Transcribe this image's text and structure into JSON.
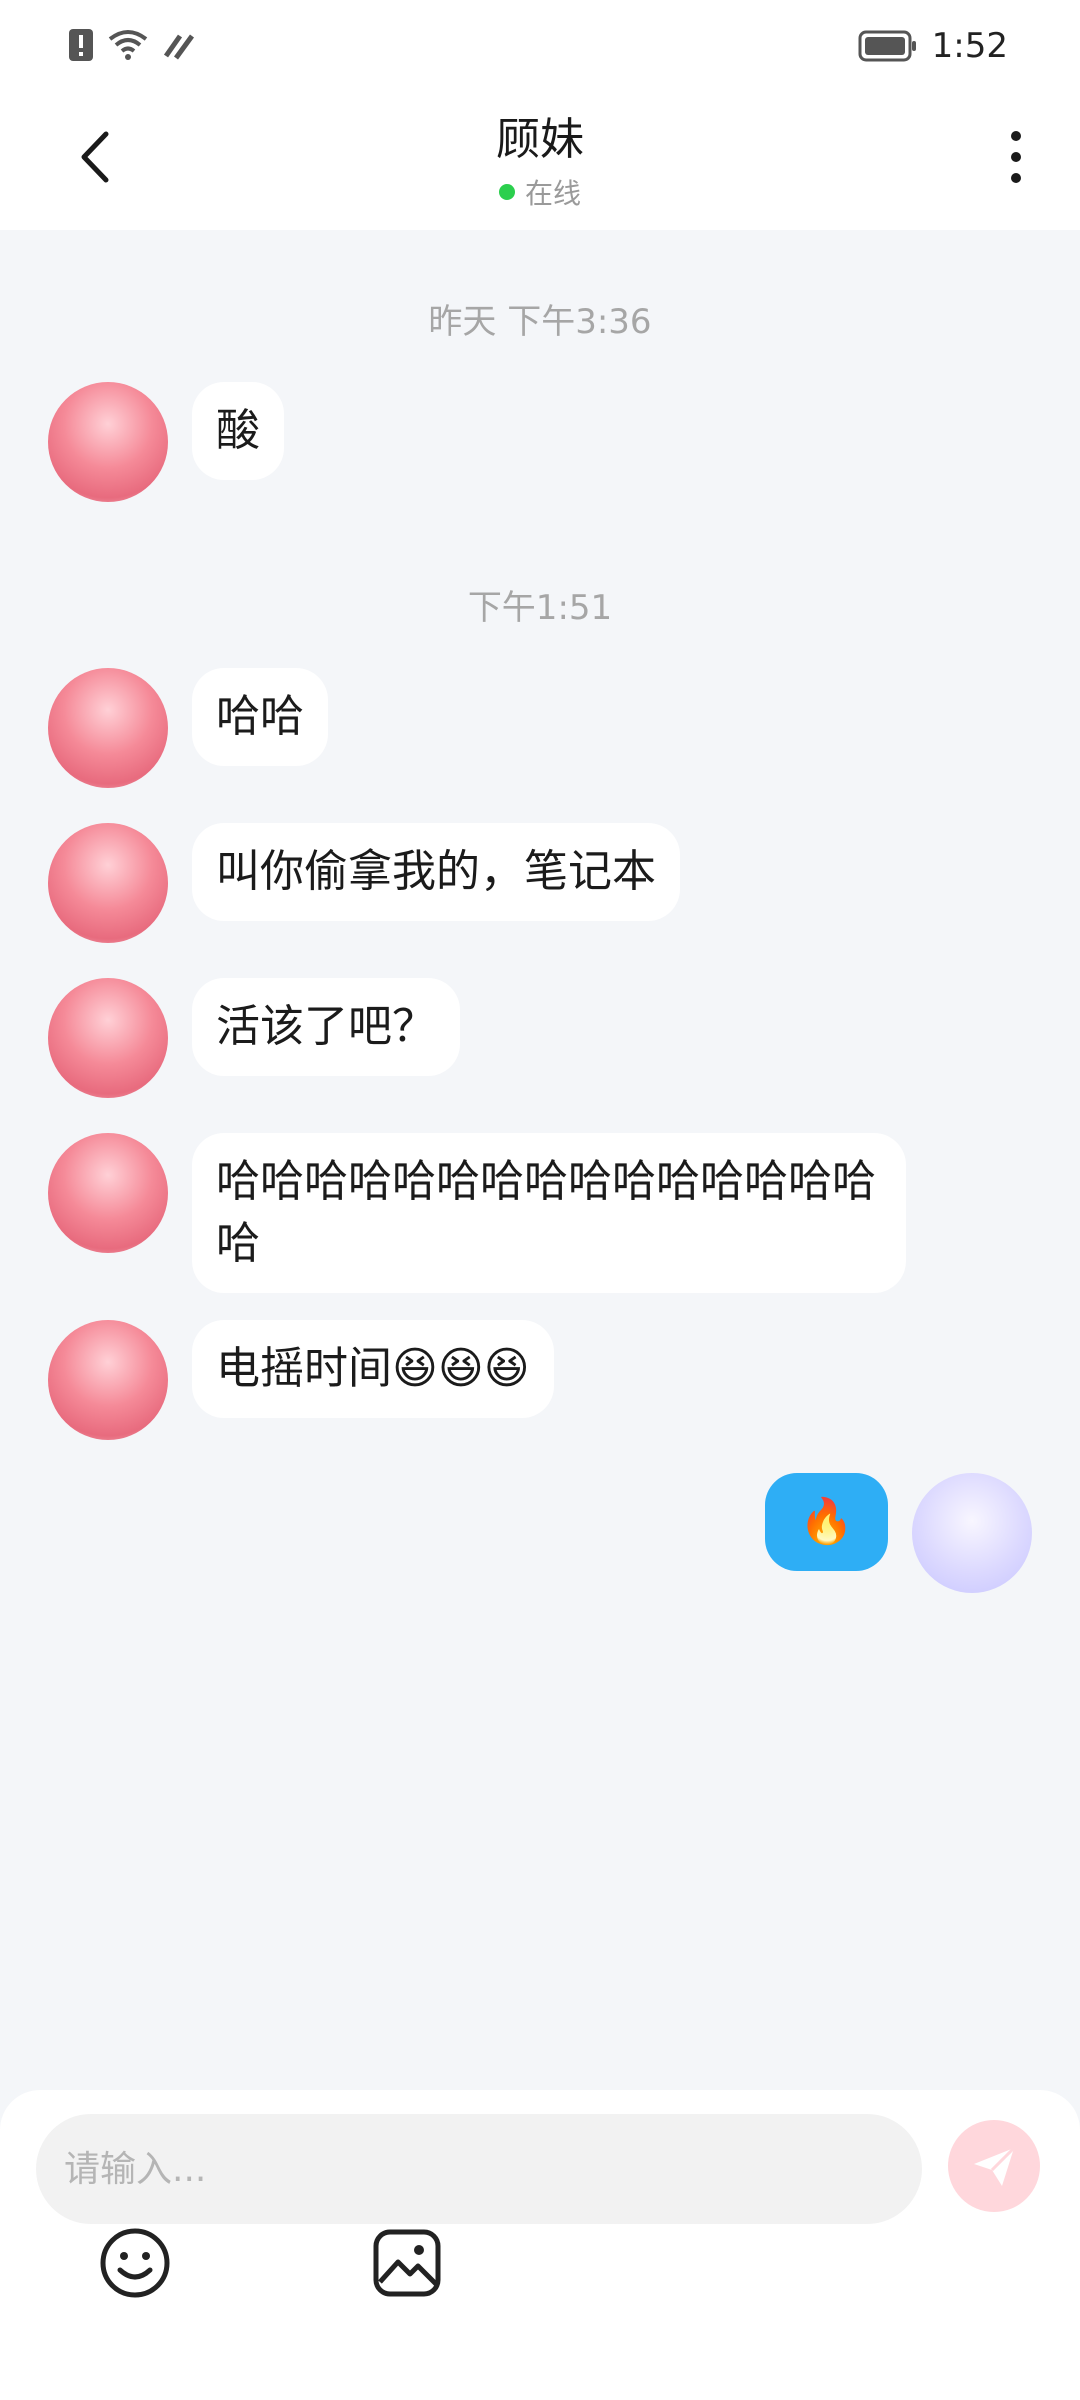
{
  "status_bar": {
    "time": "1:52"
  },
  "header": {
    "title": "顾妹",
    "status": "在线"
  },
  "timestamps": {
    "t1": "昨天 下午3:36",
    "t2": "下午1:51"
  },
  "messages": [
    {
      "side": "left",
      "text": "酸"
    },
    {
      "side": "left",
      "text": "哈哈"
    },
    {
      "side": "left",
      "text": "叫你偷拿我的，笔记本"
    },
    {
      "side": "left",
      "text": "活该了吧？"
    },
    {
      "side": "left",
      "text": "哈哈哈哈哈哈哈哈哈哈哈哈哈哈哈哈"
    },
    {
      "side": "left",
      "text": "电摇时间😆😆😆"
    },
    {
      "side": "right",
      "text": "🔥"
    }
  ],
  "input": {
    "placeholder": "请输入..."
  },
  "icons": {
    "back": "chevron-left-icon",
    "more": "more-vertical-icon",
    "send": "send-icon",
    "emoji": "emoji-icon",
    "image": "image-icon"
  },
  "colors": {
    "self_bubble": "#2eaef5",
    "online_dot": "#2bcf4d",
    "send_button": "#ffd7dc"
  }
}
